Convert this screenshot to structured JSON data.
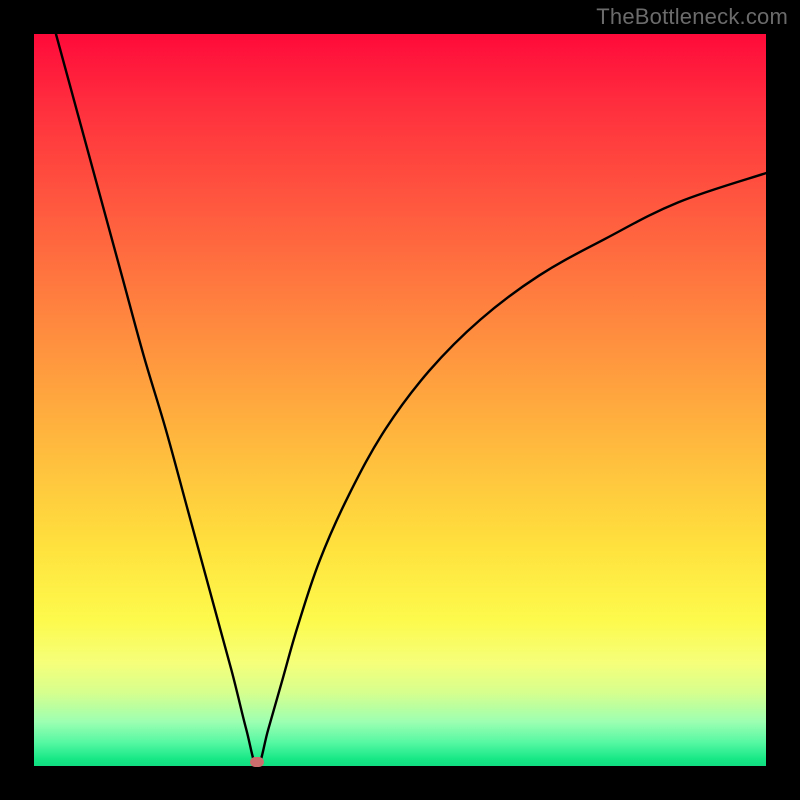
{
  "watermark": "TheBottleneck.com",
  "colors": {
    "frame": "#000000",
    "curve": "#000000",
    "marker": "#cc6d6d",
    "gradient_stops": [
      {
        "offset": 0,
        "color": "#ff0a3a"
      },
      {
        "offset": 10,
        "color": "#ff2f3e"
      },
      {
        "offset": 25,
        "color": "#ff5d3f"
      },
      {
        "offset": 40,
        "color": "#ff8a3f"
      },
      {
        "offset": 55,
        "color": "#ffb63e"
      },
      {
        "offset": 70,
        "color": "#ffe13d"
      },
      {
        "offset": 80,
        "color": "#fdfa4c"
      },
      {
        "offset": 86,
        "color": "#f5ff7a"
      },
      {
        "offset": 90,
        "color": "#d6ff8e"
      },
      {
        "offset": 94,
        "color": "#9cffb2"
      },
      {
        "offset": 97,
        "color": "#50f7a1"
      },
      {
        "offset": 99,
        "color": "#18e886"
      },
      {
        "offset": 100,
        "color": "#0fdd80"
      }
    ]
  },
  "chart_data": {
    "type": "line",
    "title": "",
    "xlabel": "",
    "ylabel": "",
    "xlim": [
      0,
      100
    ],
    "ylim": [
      0,
      100
    ],
    "grid": false,
    "legend": false,
    "annotations": [
      {
        "text": "TheBottleneck.com",
        "pos": "top-right"
      }
    ],
    "marker": {
      "x": 30.5,
      "y": 0.5
    },
    "series": [
      {
        "name": "bottleneck-curve",
        "note": "V-shaped mismatch curve: steep linear left branch, asymptotic right branch; x approx relative component strength, y approx bottleneck magnitude (0 best, 100 worst)",
        "x": [
          3,
          6,
          9,
          12,
          15,
          18,
          21,
          24,
          27,
          29,
          30.5,
          32,
          34,
          36,
          39,
          43,
          48,
          54,
          61,
          69,
          78,
          88,
          100
        ],
        "y": [
          100,
          89,
          78,
          67,
          56,
          46,
          35,
          24,
          13,
          5,
          0,
          5,
          12,
          19,
          28,
          37,
          46,
          54,
          61,
          67,
          72,
          77,
          81
        ]
      }
    ]
  }
}
